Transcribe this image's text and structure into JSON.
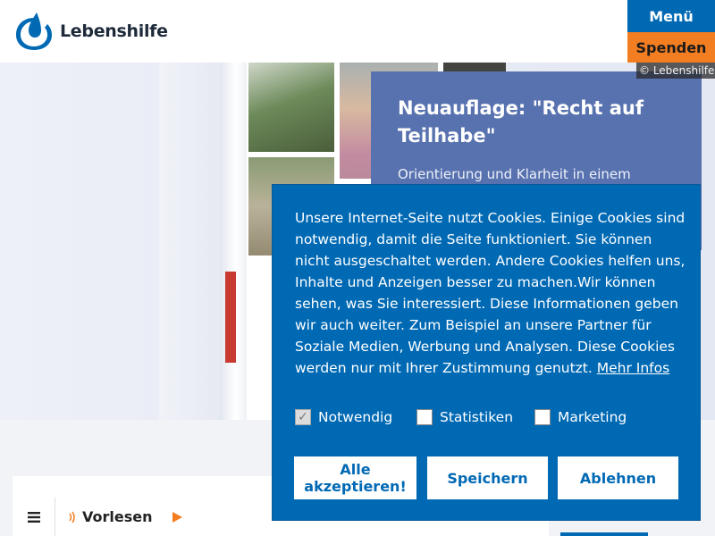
{
  "brand": {
    "name": "Lebenshilfe"
  },
  "nav": {
    "menu_label": "Menü",
    "donate_label": "Spenden"
  },
  "hero": {
    "image_credit": "© Lebenshilfe",
    "news_title": "Neuauflage: \"Recht auf Teilhabe\"",
    "news_text": "Orientierung und Klarheit in einem"
  },
  "cookie": {
    "text": "Unsere Internet-Seite nutzt Cookies. Einige Cookies sind notwendig, damit die Seite funktioniert. Sie können nicht ausgeschaltet werden. Andere Cookies helfen uns, Inhalte und Anzeigen besser zu machen.Wir können sehen, was Sie interessiert. Diese Informationen geben wir auch weiter. Zum Beispiel an unsere Partner für Soziale Medien, Werbung und Analysen. Diese Cookies werden nur mit Ihrer Zustimmung genutzt.",
    "more_info_label": "Mehr Infos",
    "options": [
      {
        "label": "Notwendig",
        "checked": true,
        "disabled": true
      },
      {
        "label": "Statistiken",
        "checked": false
      },
      {
        "label": "Marketing",
        "checked": false
      }
    ],
    "buttons": {
      "accept_all": "Alle akzeptieren!",
      "save": "Speichern",
      "reject": "Ablehnen"
    }
  },
  "readbar": {
    "label": "Vorlesen",
    "icons": [
      "menu-icon",
      "speaker-icon",
      "play-icon"
    ]
  },
  "colors": {
    "primary_blue": "#0069b4",
    "orange": "#f37e22",
    "card_blue": "#5872b0"
  }
}
